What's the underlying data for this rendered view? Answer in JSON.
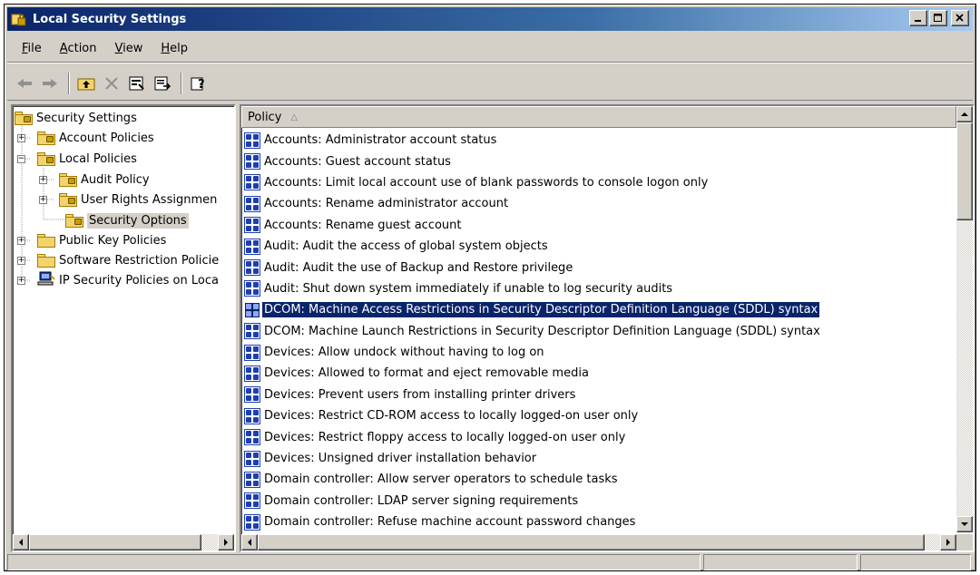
{
  "window": {
    "title": "Local Security Settings"
  },
  "menu": [
    {
      "label": "File",
      "accel": "F",
      "rest": "ile"
    },
    {
      "label": "Action",
      "accel": "A",
      "rest": "ction"
    },
    {
      "label": "View",
      "accel": "V",
      "rest": "iew"
    },
    {
      "label": "Help",
      "accel": "H",
      "rest": "elp"
    }
  ],
  "tree": {
    "root": "Security Settings",
    "items": [
      {
        "label": "Account Policies",
        "expander": "+"
      },
      {
        "label": "Local Policies",
        "expander": "−"
      },
      {
        "label": "Audit Policy",
        "expander": "+"
      },
      {
        "label": "User Rights Assignmen",
        "expander": "+"
      },
      {
        "label": "Security Options",
        "expander": ""
      },
      {
        "label": "Public Key Policies",
        "expander": "+"
      },
      {
        "label": "Software Restriction Policie",
        "expander": "+"
      },
      {
        "label": "IP Security Policies on Loca",
        "expander": "+"
      }
    ]
  },
  "list": {
    "column_header": "Policy",
    "sort_indicator": "△",
    "selected_index": 8,
    "rows": [
      "Accounts: Administrator account status",
      "Accounts: Guest account status",
      "Accounts: Limit local account use of blank passwords to console logon only",
      "Accounts: Rename administrator account",
      "Accounts: Rename guest account",
      "Audit: Audit the access of global system objects",
      "Audit: Audit the use of Backup and Restore privilege",
      "Audit: Shut down system immediately if unable to log security audits",
      "DCOM: Machine Access Restrictions in Security Descriptor Definition Language (SDDL) syntax",
      "DCOM: Machine Launch Restrictions in Security Descriptor Definition Language (SDDL) syntax",
      "Devices: Allow undock without having to log on",
      "Devices: Allowed to format and eject removable media",
      "Devices: Prevent users from installing printer drivers",
      "Devices: Restrict CD-ROM access to locally logged-on user only",
      "Devices: Restrict floppy access to locally logged-on user only",
      "Devices: Unsigned driver installation behavior",
      "Domain controller: Allow server operators to schedule tasks",
      "Domain controller: LDAP server signing requirements",
      "Domain controller: Refuse machine account password changes"
    ]
  },
  "colors": {
    "selection": "#0a246a",
    "chrome": "#d4d0c8",
    "title_start": "#0a246a",
    "title_end": "#a6caf0"
  }
}
